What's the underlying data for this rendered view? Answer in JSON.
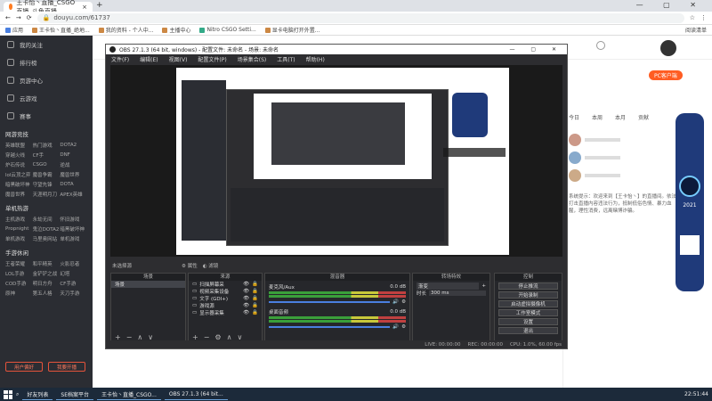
{
  "browser": {
    "tab_title": "王卡怡丶直播_CSGO直播_斗鱼直播",
    "url": "douyu.com/61737",
    "bookmarks": [
      "应用",
      "王卡怡丶直播_绝地...",
      "我的资料 - 个人中...",
      "主播中心",
      "Nitro CSGO Setti...",
      "显卡电脑打开外置..."
    ],
    "read_list": "阅读清单"
  },
  "sidebar": {
    "items": [
      "我的关注",
      "排行榜",
      "页游中心",
      "云游戏",
      "赛事"
    ],
    "sections": [
      {
        "title": "网游竞技",
        "rows": [
          [
            "英雄联盟",
            "热门游戏",
            "DOTA2"
          ],
          [
            "穿越火线",
            "CF手",
            "DNF"
          ],
          [
            "炉石传说",
            "CSGO",
            "逆战"
          ],
          [
            "lol云顶之弈",
            "魔兽争霸",
            "魔兽世界"
          ],
          [
            "暗黑破坏神",
            "守望先锋",
            "DOTA"
          ],
          [
            "魔兽世界",
            "天涯明月刀",
            "APEX英雄"
          ]
        ]
      },
      {
        "title": "单机热游",
        "rows": [
          [
            "主机游戏",
            "永劫无间",
            "怀旧游戏"
          ],
          [
            "Propnight",
            "鬼泣DOTA2",
            "暗黑破坏神"
          ],
          [
            "单机游戏",
            "马里奥网站",
            "单机游戏"
          ]
        ]
      },
      {
        "title": "手游休闲",
        "rows": [
          [
            "王者荣耀",
            "和平精英",
            "火影忍者"
          ],
          [
            "LOL手游",
            "金铲铲之战",
            "幻塔"
          ],
          [
            "COD手游",
            "明日方舟",
            "CF手游"
          ],
          [
            "原神",
            "第五人格",
            "天刀手游"
          ]
        ]
      }
    ],
    "btn_apply": "用户偏好",
    "btn_live": "我要开播"
  },
  "obs": {
    "title": "OBS 27.1.3 (64 bit, windows) - 配置文件: 未命名 - 场景: 未命名",
    "menu": [
      "文件(F)",
      "编辑(E)",
      "视图(V)",
      "配置文件(P)",
      "场景集合(S)",
      "工具(T)",
      "帮助(H)"
    ],
    "no_source": "未选择源",
    "props": "属性",
    "filters": "滤镜",
    "docks": {
      "scenes": "场景",
      "sources": "来源",
      "mixer": "混音器",
      "transitions": "转场特效",
      "controls": "控制"
    },
    "scene_items": [
      "场景"
    ],
    "source_items": [
      "扫描屏幕采",
      "视频采集设备",
      "文字 (GDI+)",
      "游戏源",
      "显示器采集"
    ],
    "mixer": [
      {
        "name": "麦克风/Aux",
        "db": "0.0 dB"
      },
      {
        "name": "桌面音频",
        "db": "0.0 dB"
      }
    ],
    "transition": {
      "mode": "渐变",
      "duration_label": "时长",
      "duration": "300 ms"
    },
    "controls": [
      "停止推流",
      "开始录制",
      "启动虚拟摄像机",
      "工作室模式",
      "设置",
      "退出"
    ],
    "status": {
      "live": "LIVE: 00:00:00",
      "rec": "REC: 00:00:00",
      "cpu": "CPU: 1.0%, 60.00 fps"
    }
  },
  "right": {
    "nav": [
      "今日",
      "本周",
      "本月",
      "贡献"
    ],
    "notice": "系统提示：欢迎来到【王卡怡丶】的直播间。依法打击直播内容违法行为，抵制低俗色情、暴力血腥，理性消费，远离赌博诈骗。",
    "year": "2021"
  },
  "taskbar": {
    "items": [
      "好友列表",
      "SE档案平台",
      "王卡怡丶直播_CSGO...",
      "OBS 27.1.3 (64 bit..."
    ],
    "time": "22:51:44"
  }
}
